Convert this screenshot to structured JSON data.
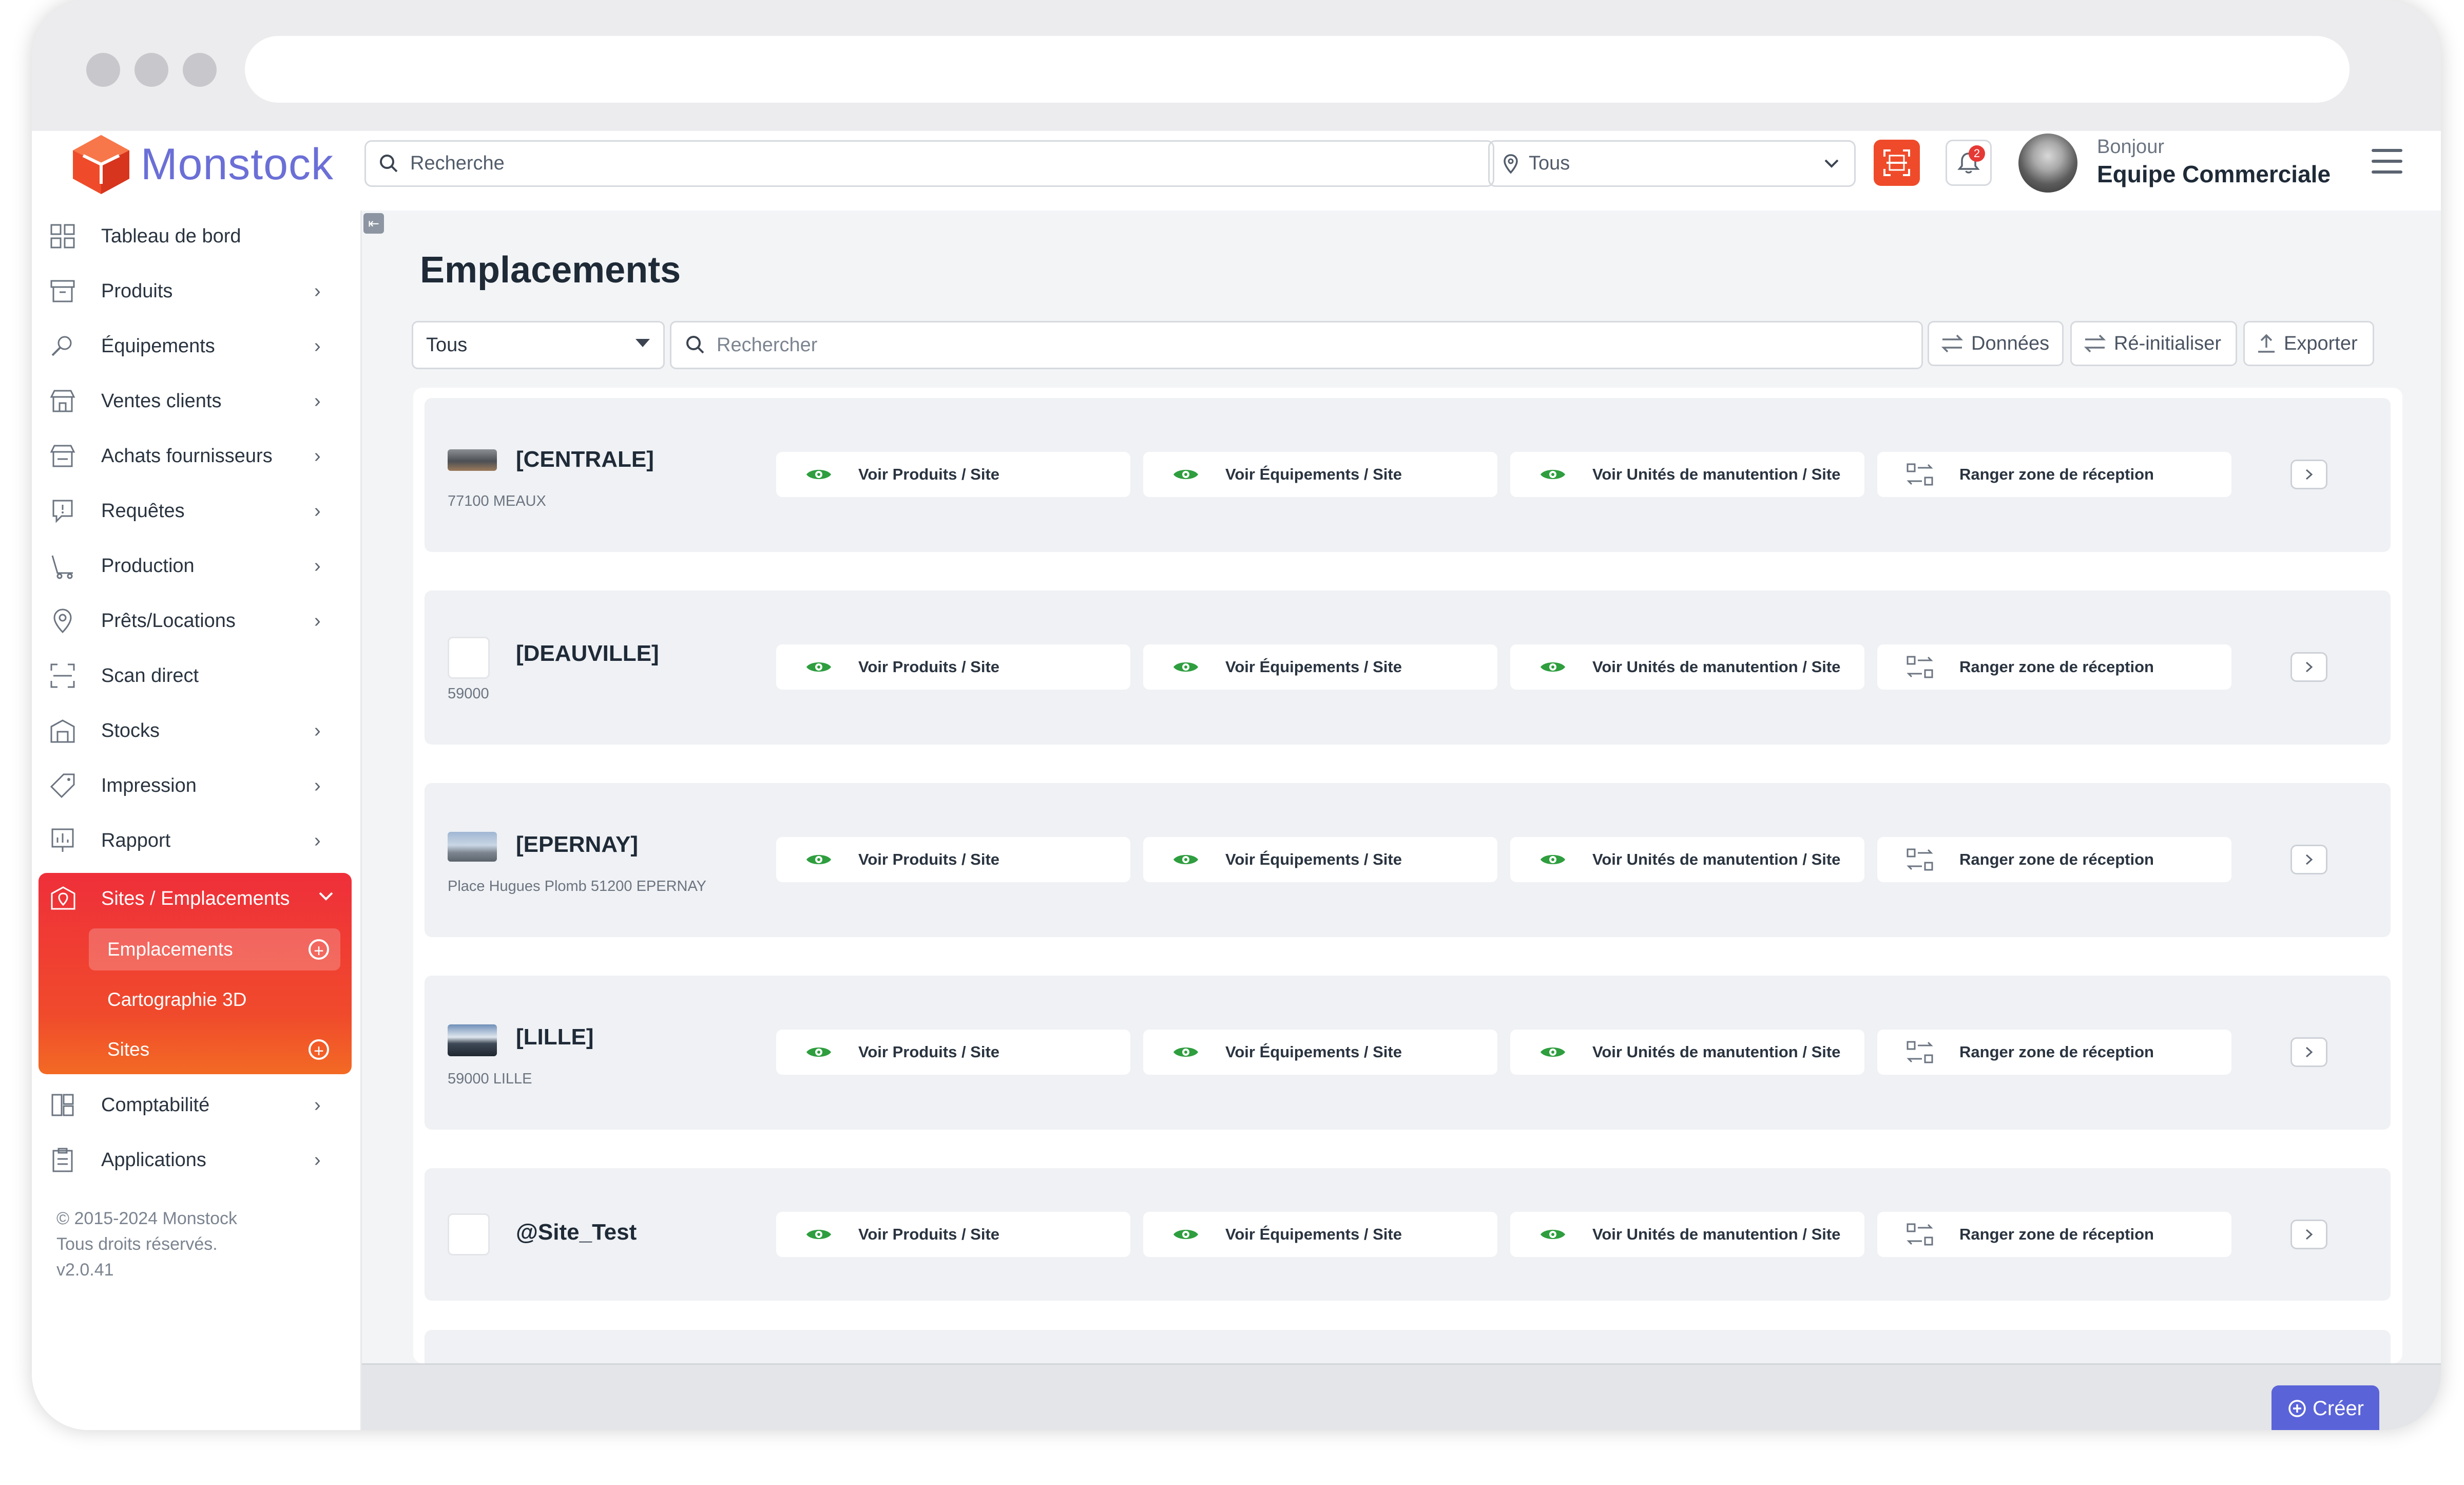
{
  "app": {
    "logo_text": "Monstock"
  },
  "header": {
    "search_placeholder": "Recherche",
    "site_selected": "Tous",
    "notifications_count": "2",
    "greeting": "Bonjour",
    "user_name": "Equipe Commerciale"
  },
  "sidebar": {
    "items": [
      {
        "label": "Tableau de bord",
        "icon": "dashboard-icon"
      },
      {
        "label": "Produits",
        "icon": "box-icon"
      },
      {
        "label": "Équipements",
        "icon": "equipment-icon"
      },
      {
        "label": "Ventes clients",
        "icon": "store-icon"
      },
      {
        "label": "Achats fournisseurs",
        "icon": "supplier-icon"
      },
      {
        "label": "Requêtes",
        "icon": "request-icon"
      },
      {
        "label": "Production",
        "icon": "production-icon"
      },
      {
        "label": "Prêts/Locations",
        "icon": "location-pin-icon"
      },
      {
        "label": "Scan direct",
        "icon": "scan-icon"
      },
      {
        "label": "Stocks",
        "icon": "warehouse-icon"
      },
      {
        "label": "Impression",
        "icon": "tag-icon"
      },
      {
        "label": "Rapport",
        "icon": "report-icon"
      }
    ],
    "active_group": {
      "label": "Sites / Emplacements",
      "sub_items": [
        {
          "label": "Emplacements"
        },
        {
          "label": "Cartographie 3D"
        },
        {
          "label": "Sites"
        }
      ]
    },
    "bottom_items": [
      {
        "label": "Comptabilité"
      },
      {
        "label": "Applications"
      }
    ],
    "copyright": [
      "© 2015-2024 Monstock",
      "Tous droits réservés.",
      "v2.0.41"
    ]
  },
  "main": {
    "title": "Emplacements",
    "filter_value": "Tous",
    "search_placeholder": "Rechercher",
    "buttons": {
      "data": "Données",
      "reset": "Ré-initialiser",
      "export": "Exporter"
    },
    "action_labels": {
      "products": "Voir Produits / Site",
      "equipments": "Voir Équipements / Site",
      "handling_units": "Voir Unités de manutention / Site",
      "receive": "Ranger zone de réception"
    },
    "sites": [
      {
        "name": "[CENTRALE]",
        "address": "77100 MEAUX"
      },
      {
        "name": "[DEAUVILLE]",
        "address": "59000"
      },
      {
        "name": "[EPERNAY]",
        "address": "Place Hugues Plomb 51200 EPERNAY"
      },
      {
        "name": "[LILLE]",
        "address": "59000 LILLE"
      },
      {
        "name": "@Site_Test",
        "address": ""
      }
    ],
    "create_label": "Créer"
  },
  "colors": {
    "accent": "#ef3b32",
    "brand": "#6b6fd6",
    "eye": "#2e9e3e",
    "create": "#5a63d8"
  }
}
